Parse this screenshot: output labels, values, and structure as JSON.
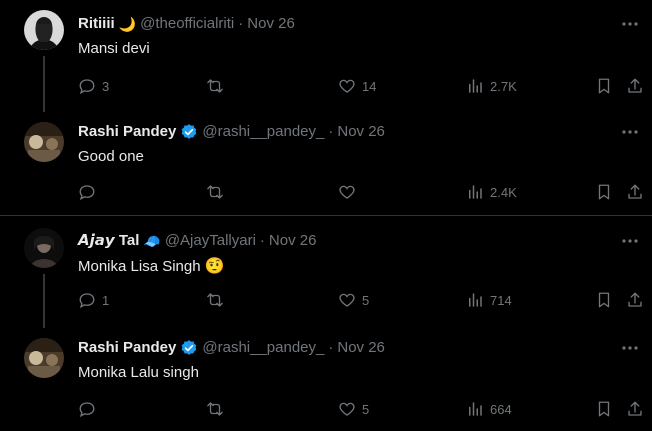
{
  "tweets": [
    {
      "name": "Ritiiii",
      "name_emoji": "🌙",
      "handle": "@theofficialriti",
      "sep": "·",
      "date": "Nov 26",
      "text": "Mansi devi",
      "replies": "3",
      "retweets": "",
      "likes": "14",
      "views": "2.7K"
    },
    {
      "name": "Rashi Pandey",
      "verified": true,
      "handle": "@rashi__pandey_",
      "sep": "·",
      "date": "Nov 26",
      "text": "Good one",
      "replies": "",
      "retweets": "",
      "likes": "",
      "views": "2.4K"
    },
    {
      "name": "𝘼𝙟𝙖𝙮 Tal",
      "name_emoji": "🧢",
      "handle": "@AjayTallyari",
      "sep": "·",
      "date": "Nov 26",
      "text": "Monika Lisa Singh",
      "text_emoji": "🤨",
      "replies": "1",
      "retweets": "",
      "likes": "5",
      "views": "714"
    },
    {
      "name": "Rashi Pandey",
      "verified": true,
      "handle": "@rashi__pandey_",
      "sep": "·",
      "date": "Nov 26",
      "text": "Monika Lalu singh",
      "replies": "",
      "retweets": "",
      "likes": "5",
      "views": "664"
    }
  ],
  "colors": {
    "background": "#000000",
    "text": "#e7e9ea",
    "muted": "#71767b",
    "divider": "#2f3336",
    "verified": "#1d9bf0"
  }
}
